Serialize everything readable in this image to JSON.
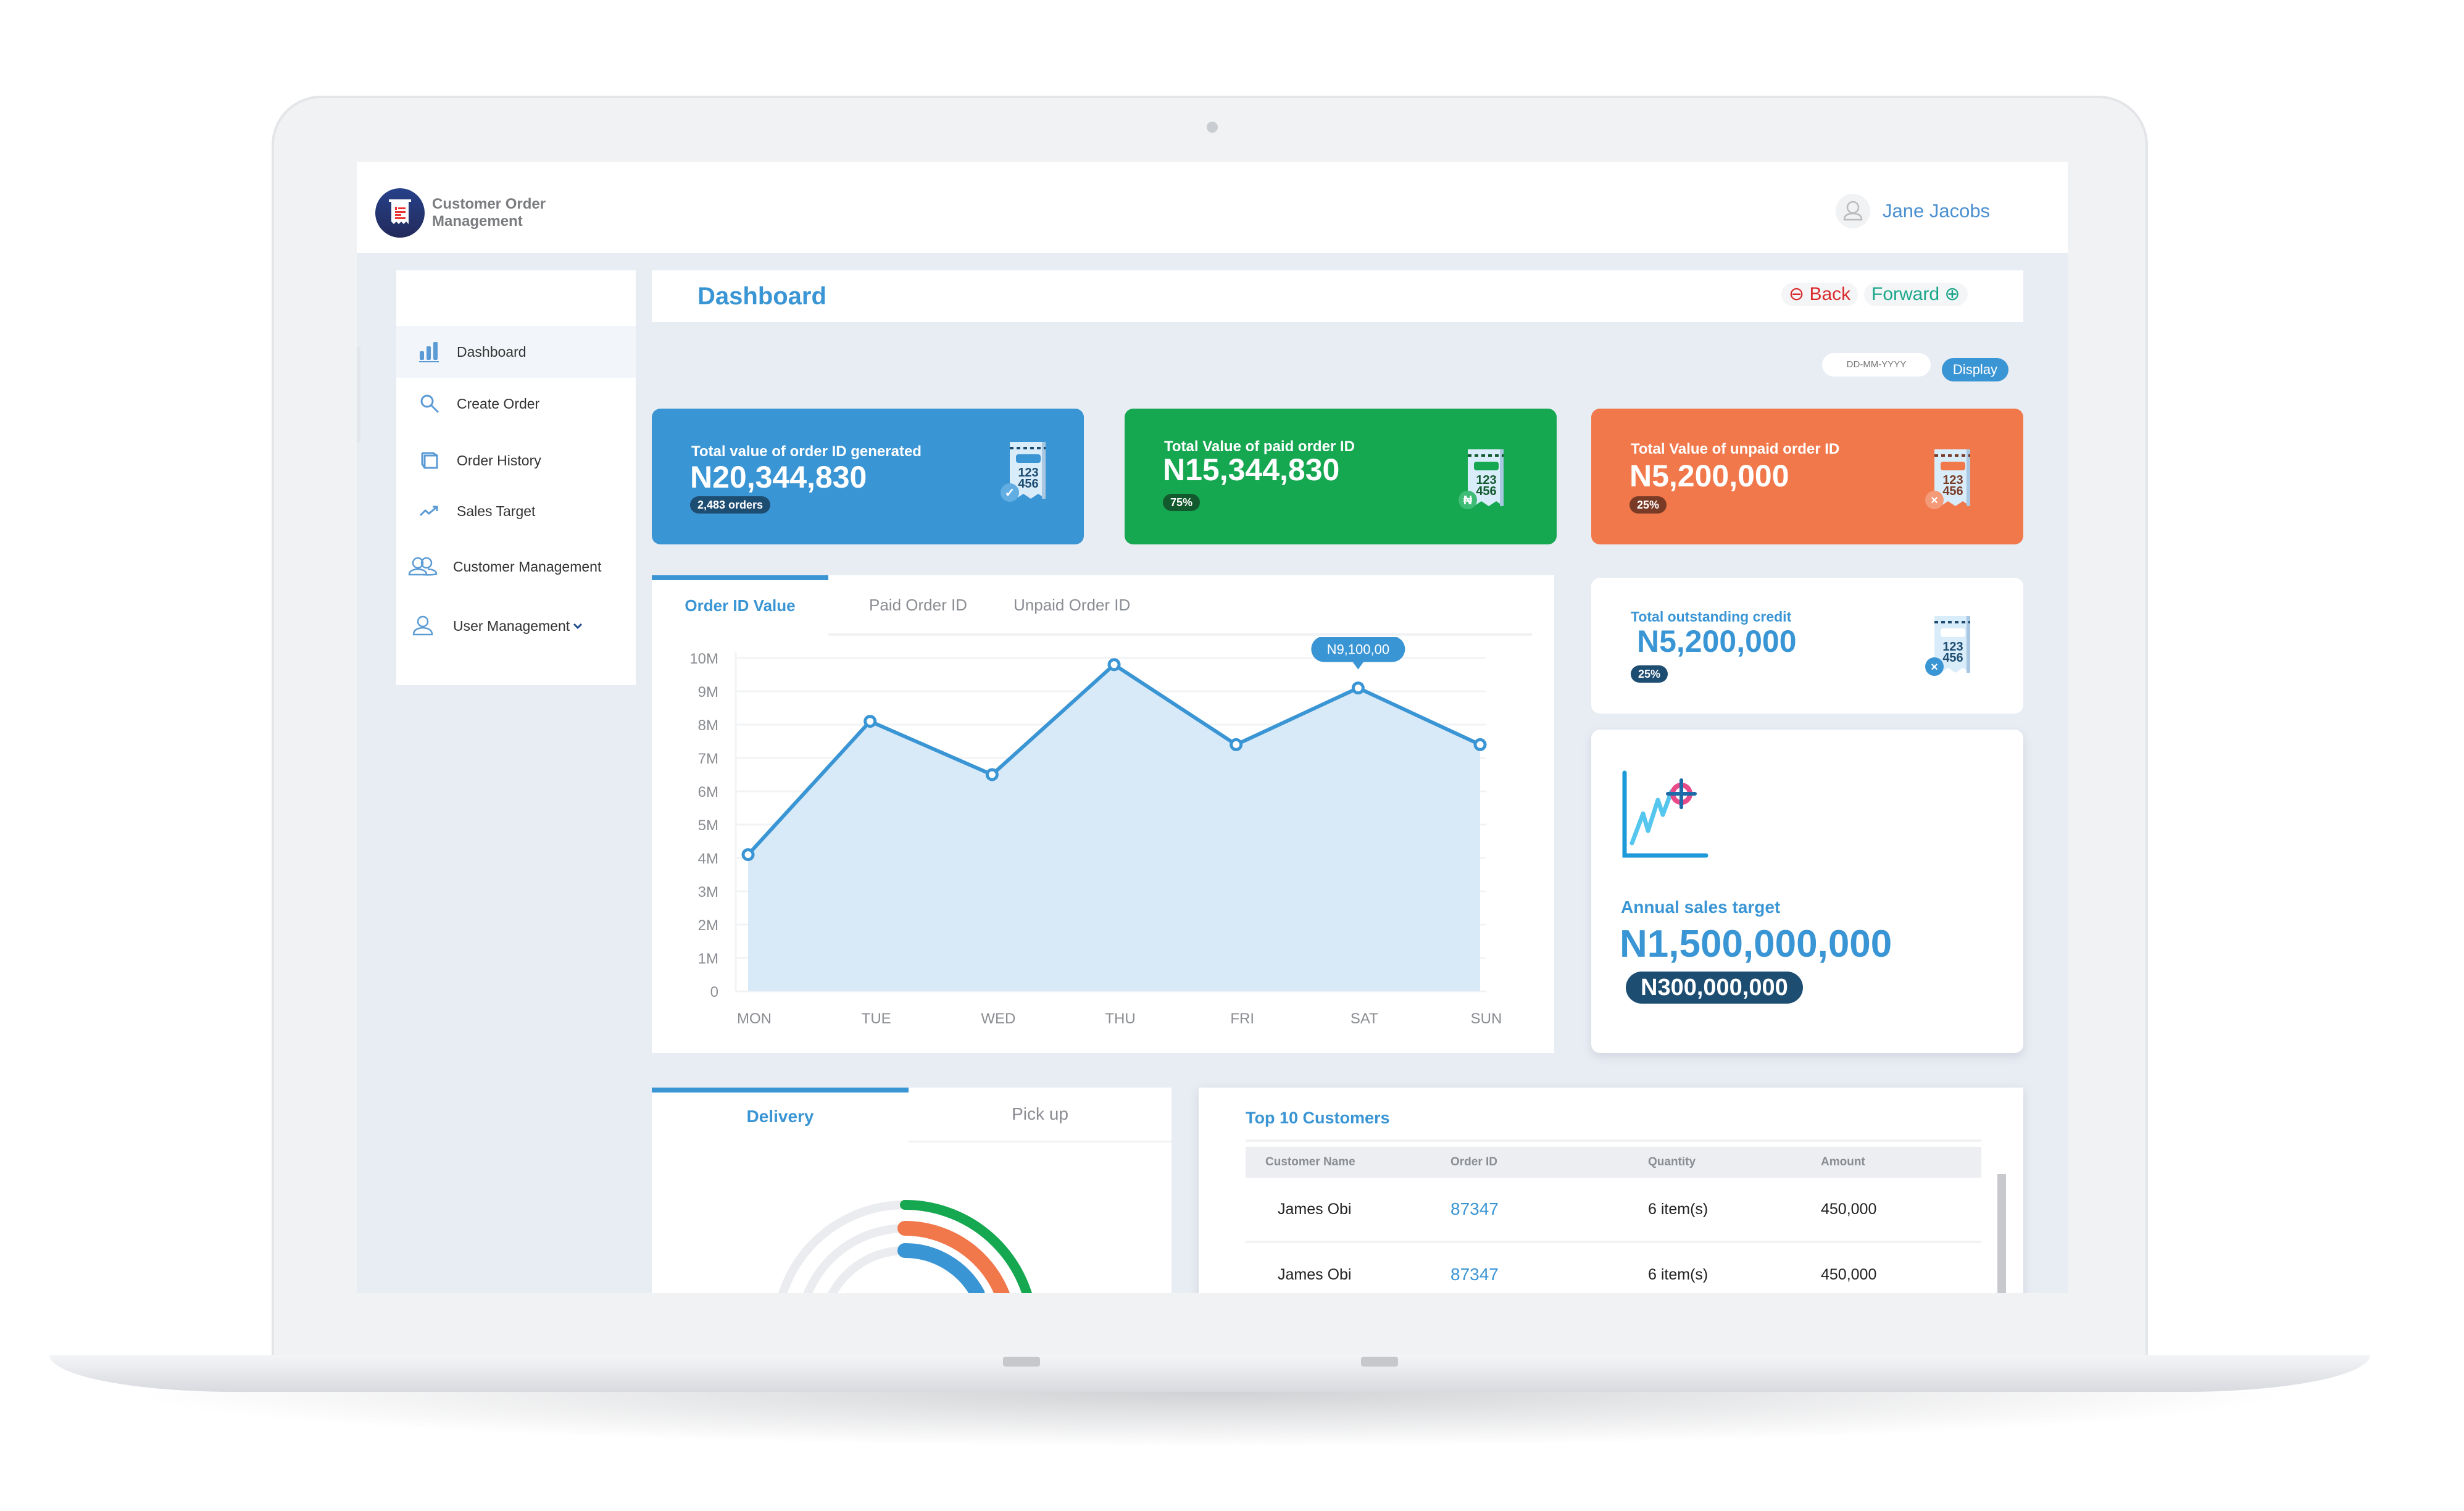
{
  "app": {
    "name_line1": "Customer Order",
    "name_line2": "Management",
    "user_name": "Jane Jacobs"
  },
  "sidebar": {
    "items": [
      {
        "label": "Dashboard",
        "icon": "bar-chart-icon",
        "active": true
      },
      {
        "label": "Create Order",
        "icon": "search-icon"
      },
      {
        "label": "Order History",
        "icon": "box-icon"
      },
      {
        "label": "Sales Target",
        "icon": "trend-up-icon"
      },
      {
        "label": "Customer Management",
        "icon": "users-icon"
      },
      {
        "label": "User Management",
        "icon": "user-icon",
        "has_dropdown": true
      }
    ]
  },
  "page": {
    "title": "Dashboard",
    "back_label": "Back",
    "forward_label": "Forward",
    "date_placeholder": "DD-MM-YYYY",
    "display_label": "Display"
  },
  "kpis": [
    {
      "label": "Total value of order ID generated",
      "value": "N20,344,830",
      "badge": "2,483 orders",
      "color": "#3a95d4",
      "badge_color": "#1e4d72",
      "icon": "receipt-check-icon"
    },
    {
      "label": "Total Value of paid order ID",
      "value": "N15,344,830",
      "badge": "75%",
      "color": "#16a751",
      "badge_color": "#125a2e",
      "icon": "receipt-naira-icon"
    },
    {
      "label": "Total Value of unpaid order ID",
      "value": "N5,200,000",
      "badge": "25%",
      "color": "#f1784b",
      "badge_color": "#7a3b26",
      "icon": "receipt-x-icon"
    }
  ],
  "credit": {
    "label": "Total outstanding credit",
    "value": "N5,200,000",
    "badge": "25%"
  },
  "sales_target": {
    "label": "Annual sales target",
    "value": "N1,500,000,000",
    "badge": "N300,000,000"
  },
  "chart_tabs": [
    "Order ID Value",
    "Paid Order ID",
    "Unpaid Order ID"
  ],
  "chart_data": {
    "type": "area",
    "title": "Order ID Value",
    "categories": [
      "MON",
      "TUE",
      "WED",
      "THU",
      "FRI",
      "SAT",
      "SUN"
    ],
    "values": [
      4100000,
      8100000,
      6500000,
      9800000,
      7400000,
      9100000,
      7400000
    ],
    "y_ticks": [
      "0",
      "1M",
      "2M",
      "3M",
      "4M",
      "5M",
      "6M",
      "7M",
      "8M",
      "9M",
      "10M"
    ],
    "ylim": [
      0,
      10000000
    ],
    "xlabel": "",
    "ylabel": "",
    "grid": true,
    "tooltip": {
      "category": "SAT",
      "text": "N9,100,00"
    },
    "color": "#3a95d4",
    "fill": "#d8e9f8"
  },
  "shipping": {
    "tabs": [
      "Delivery",
      "Pick up"
    ],
    "rings": [
      {
        "color": "#16a751",
        "fraction": 0.25
      },
      {
        "color": "#f1784b",
        "fraction": 0.25
      },
      {
        "color": "#3a95d4",
        "fraction": 0.17
      }
    ]
  },
  "customers": {
    "title": "Top 10 Customers",
    "columns": [
      "Customer Name",
      "Order ID",
      "Quantity",
      "Amount"
    ],
    "rows": [
      [
        "James Obi",
        "87347",
        "6 item(s)",
        "450,000"
      ],
      [
        "James Obi",
        "87347",
        "6 item(s)",
        "450,000"
      ]
    ]
  }
}
